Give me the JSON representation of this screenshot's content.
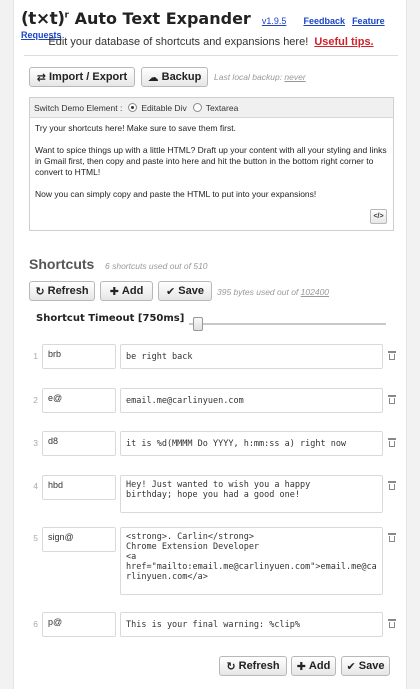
{
  "header": {
    "logo": "(t×t)",
    "title": "Auto Text Expander",
    "version": "v1.9.5",
    "feedback": "Feedback",
    "feature_requests": "Feature Requests",
    "subtitle": "Edit your database of shortcuts and expansions here!",
    "useful_tips": "Useful tips."
  },
  "toolbar": {
    "import_export": "Import / Export",
    "backup": "Backup",
    "last_backup_label": "Last local backup:",
    "last_backup_value": "never"
  },
  "demo": {
    "switch_label": "Switch Demo Element :",
    "options": [
      "Editable Div",
      "Textarea"
    ],
    "selected": "Editable Div",
    "paragraphs": [
      "Try your shortcuts here! Make sure to save them first.",
      "Want to spice things up with a little HTML? Draft up your content with all your styling and links in Gmail first, then copy and paste into here and hit the button in the bottom right corner to convert to HTML!",
      "Now you can simply copy and paste the HTML to put into your expansions!"
    ],
    "convert_button": "</>"
  },
  "shortcuts": {
    "title": "Shortcuts",
    "count_text": "6 shortcuts used out of 510",
    "refresh": "Refresh",
    "add": "Add",
    "save": "Save",
    "bytes_text": "395 bytes used out of",
    "bytes_limit": "102400",
    "timeout_label": "Shortcut Timeout [750ms]",
    "timeout_ms": 750,
    "rows": [
      {
        "num": "1",
        "key": "brb",
        "value": "be right back"
      },
      {
        "num": "2",
        "key": "e@",
        "value": "email.me@carlinyuen.com"
      },
      {
        "num": "3",
        "key": "d8",
        "value": "it is %d(MMMM Do YYYY, h:mm:ss a) right now"
      },
      {
        "num": "4",
        "key": "hbd",
        "value": "Hey! Just wanted to wish you a happy\nbirthday; hope you had a good one!"
      },
      {
        "num": "5",
        "key": "sign@",
        "value": "<strong>. Carlin</strong>\nChrome Extension Developer\n<a\nhref=\"mailto:email.me@carlinyuen.com\">email.me@carlinyuen.com</a>"
      },
      {
        "num": "6",
        "key": "p@",
        "value": "This is your final warning: %clip%"
      }
    ]
  },
  "footer": {
    "refresh": "Refresh",
    "add": "Add",
    "save": "Save"
  },
  "icons": {
    "import_export": "swap-arrows-icon",
    "backup": "backup-icon",
    "refresh": "refresh-icon",
    "add": "plus-icon",
    "save": "check-icon",
    "delete": "trash-icon"
  }
}
